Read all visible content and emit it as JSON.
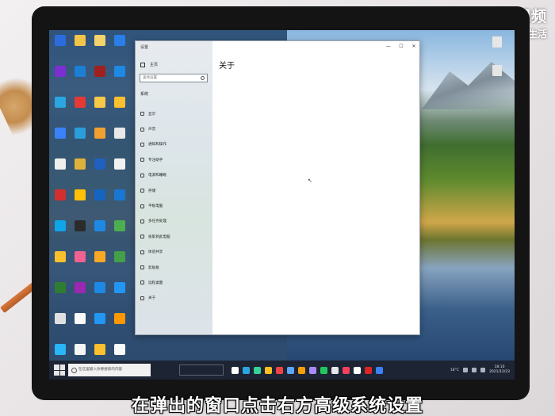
{
  "watermark": {
    "line1": "天奇·视频",
    "line2": "天奇生活"
  },
  "caption": "在弹出的窗口点击右方高级系统设置",
  "colors": {
    "taskbar": "#1d2433",
    "settings_nav_bg": "#e2e8ec",
    "content_bg": "#ffffff",
    "caption_text": "#ffffff"
  },
  "desktop": {
    "icons": [
      {
        "label": "",
        "color": "#2d6cdf"
      },
      {
        "label": "",
        "color": "#f0c54a"
      },
      {
        "label": "",
        "color": "#f3d36b"
      },
      {
        "label": "",
        "color": "#2a7ee8"
      },
      {
        "label": "",
        "color": "#7b2fd0"
      },
      {
        "label": "",
        "color": "#1b7fd4"
      },
      {
        "label": "",
        "color": "#a0201f"
      },
      {
        "label": "",
        "color": "#1e88e5"
      },
      {
        "label": "",
        "color": "#2aa6e0"
      },
      {
        "label": "",
        "color": "#e53935"
      },
      {
        "label": "",
        "color": "#f7c948"
      },
      {
        "label": "",
        "color": "#fbc02d"
      },
      {
        "label": "",
        "color": "#3b82f6"
      },
      {
        "label": "",
        "color": "#2c9cdb"
      },
      {
        "label": "",
        "color": "#f0a030"
      },
      {
        "label": "",
        "color": "#e8e8e8"
      },
      {
        "label": "",
        "color": "#eeeeee"
      },
      {
        "label": "",
        "color": "#e0b13a"
      },
      {
        "label": "",
        "color": "#2060c0"
      },
      {
        "label": "",
        "color": "#f2f2f2"
      },
      {
        "label": "",
        "color": "#d32f2f"
      },
      {
        "label": "",
        "color": "#ffc107"
      },
      {
        "label": "",
        "color": "#1565c0"
      },
      {
        "label": "",
        "color": "#1976d2"
      },
      {
        "label": "",
        "color": "#0ea5e9"
      },
      {
        "label": "",
        "color": "#2b2b2b"
      },
      {
        "label": "",
        "color": "#1e88e5"
      },
      {
        "label": "",
        "color": "#4caf50"
      },
      {
        "label": "",
        "color": "#fbc02d"
      },
      {
        "label": "",
        "color": "#f06292"
      },
      {
        "label": "",
        "color": "#f9a825"
      },
      {
        "label": "",
        "color": "#43a047"
      },
      {
        "label": "",
        "color": "#2e7d32"
      },
      {
        "label": "",
        "color": "#9c27b0"
      },
      {
        "label": "",
        "color": "#1e88e5"
      },
      {
        "label": "",
        "color": "#2196f3"
      },
      {
        "label": "",
        "color": "#e0e0e0"
      },
      {
        "label": "",
        "color": "#fafafa"
      },
      {
        "label": "",
        "color": "#2196f3"
      },
      {
        "label": "",
        "color": "#ff9800"
      },
      {
        "label": "",
        "color": "#29b6f6"
      },
      {
        "label": "",
        "color": "#f5f5f5"
      },
      {
        "label": "",
        "color": "#fbc02d"
      },
      {
        "label": "",
        "color": "#fafafa"
      }
    ]
  },
  "settings": {
    "window_title": "设置",
    "home": "主页",
    "search_placeholder": "查找设置",
    "section": "系统",
    "page_title": "关于",
    "controls": {
      "minimize": "—",
      "maximize": "☐",
      "close": "✕"
    },
    "nav_items": [
      {
        "label": "显示",
        "icon": "display-icon"
      },
      {
        "label": "声音",
        "icon": "sound-icon"
      },
      {
        "label": "通知和操作",
        "icon": "notification-icon"
      },
      {
        "label": "专注助手",
        "icon": "focus-icon"
      },
      {
        "label": "电源和睡眠",
        "icon": "power-icon"
      },
      {
        "label": "存储",
        "icon": "storage-icon"
      },
      {
        "label": "平板电脑",
        "icon": "tablet-icon"
      },
      {
        "label": "多任务处理",
        "icon": "multitask-icon"
      },
      {
        "label": "投影到此电脑",
        "icon": "project-icon"
      },
      {
        "label": "体验共享",
        "icon": "share-icon"
      },
      {
        "label": "剪贴板",
        "icon": "clipboard-icon"
      },
      {
        "label": "远程桌面",
        "icon": "remote-icon"
      },
      {
        "label": "关于",
        "icon": "info-icon"
      }
    ]
  },
  "taskbar": {
    "search_placeholder": "在这里输入你要搜索的内容",
    "weather": "18°C",
    "time": "18:10",
    "date": "2021/12/23",
    "app_colors": [
      "#ffffff",
      "#2aa6e0",
      "#34d399",
      "#fbbf24",
      "#ef4444",
      "#60a5fa",
      "#f59e0b",
      "#a78bfa",
      "#22c55e",
      "#e5e7eb",
      "#f43f5e",
      "#ffffff",
      "#dc2626",
      "#3b82f6"
    ]
  }
}
